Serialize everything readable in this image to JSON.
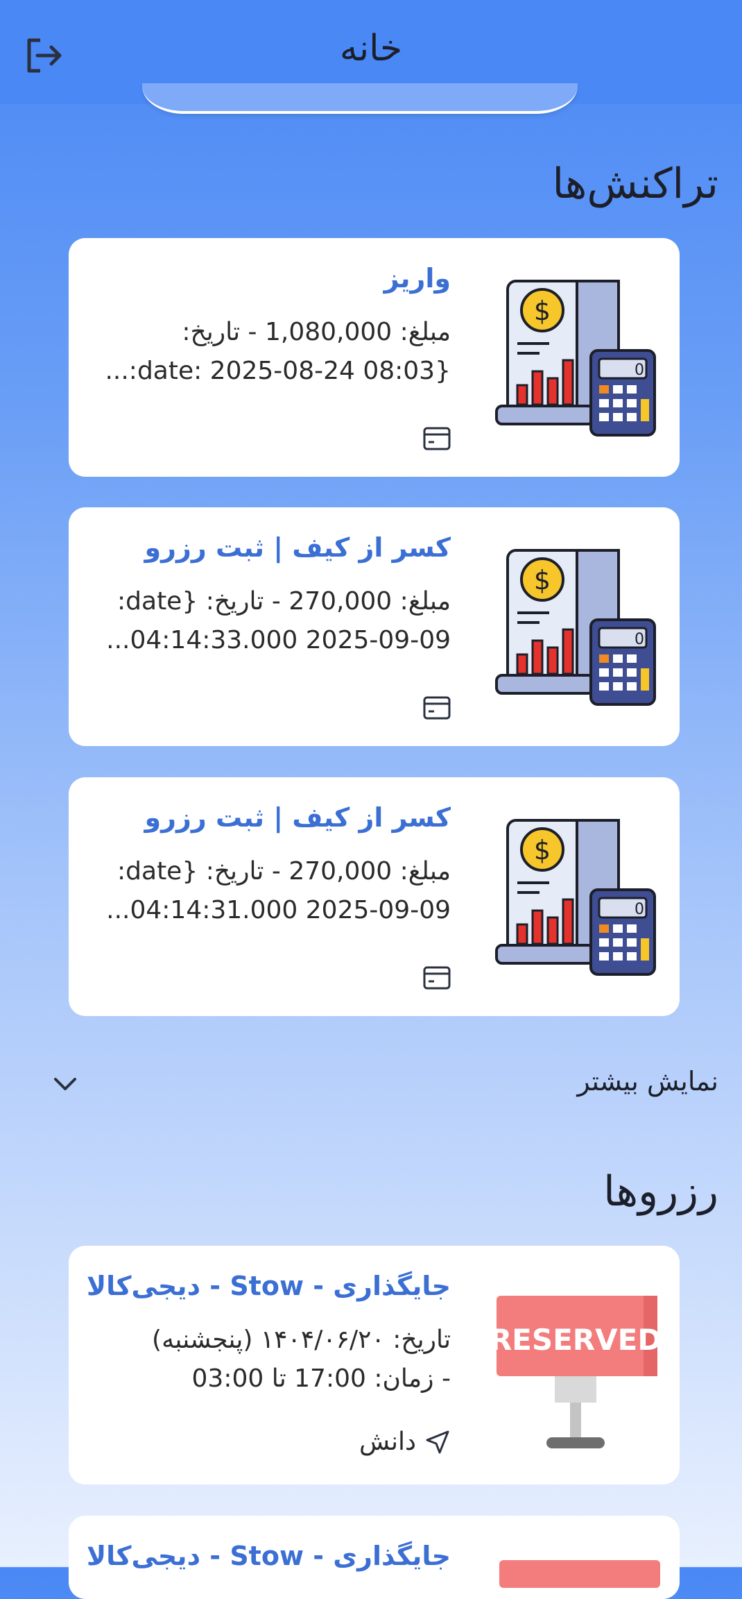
{
  "appbar": {
    "title": "خانه",
    "logout_icon": "logout-icon"
  },
  "transactions": {
    "title": "تراکنش‌ها",
    "items": [
      {
        "title": "واریز",
        "line1": "مبلغ: 1,080,000 - تاریخ:",
        "line2": "{date: 2025-08-24 08:03:...",
        "icon": "credit-card-icon"
      },
      {
        "title": "کسر از کیف | ثبت رزرو",
        "line1": "مبلغ: 270,000 - تاریخ: {date:",
        "line2": "2025-09-09 04:14:33.000...",
        "icon": "credit-card-icon"
      },
      {
        "title": "کسر از کیف | ثبت رزرو",
        "line1": "مبلغ: 270,000 - تاریخ: {date:",
        "line2": "2025-09-09 04:14:31.000...",
        "icon": "credit-card-icon"
      }
    ],
    "show_more": "نمایش بیشتر"
  },
  "reservations": {
    "title": "رزروها",
    "items": [
      {
        "title": "جایگذاری - Stow - دیجی‌کالا",
        "line1": "تاریخ: ۱۴۰۴/۰۶/۲۰ (پنجشنبه)",
        "line2": "- زمان: 17:00 تا 03:00",
        "location": "دانش",
        "badge": "RESERVED"
      },
      {
        "title": "جایگذاری - Stow - دیجی‌کالا"
      }
    ]
  },
  "colors": {
    "accent": "#3b6fd4",
    "appbar": "#4a88f5",
    "reserved": "#f37c7c"
  }
}
